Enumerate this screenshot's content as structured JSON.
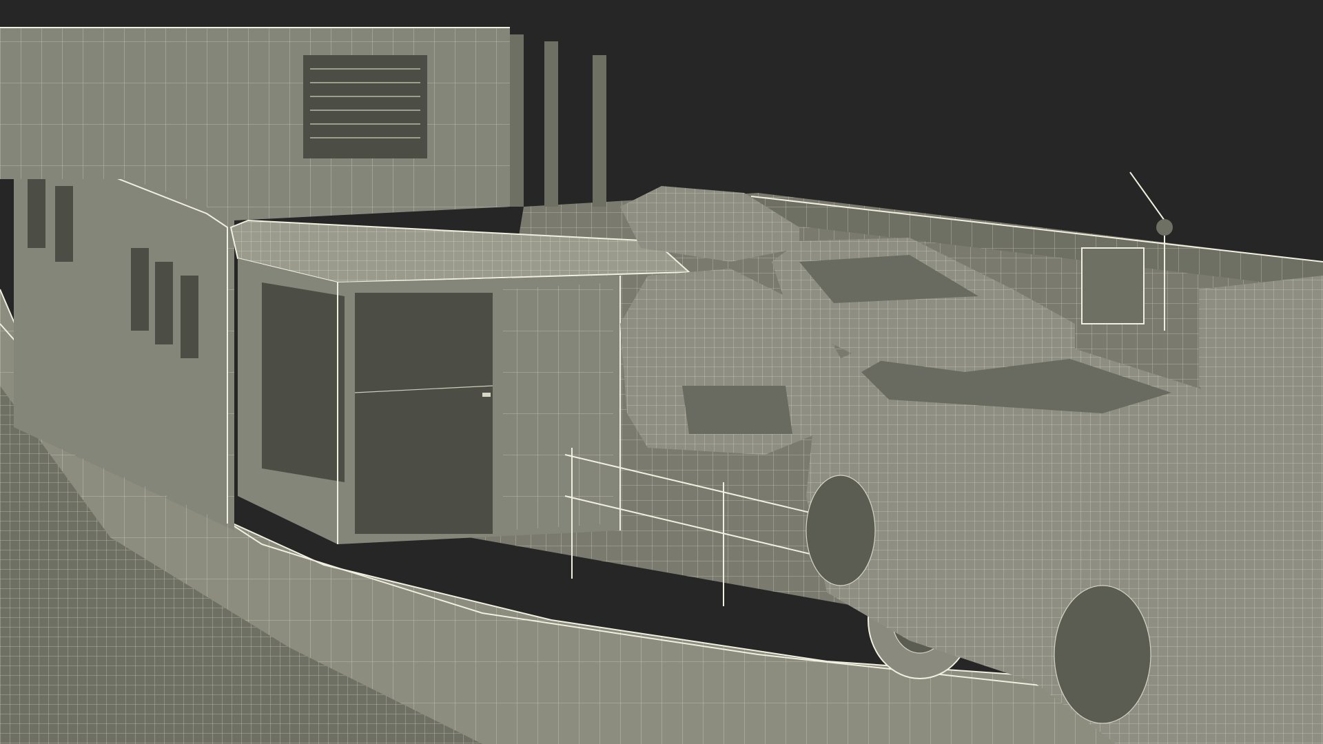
{
  "scene": {
    "subject": "",
    "background_color": "#262626",
    "model_color": "#8c8d7f",
    "wire_color": "#e6e4d4"
  }
}
